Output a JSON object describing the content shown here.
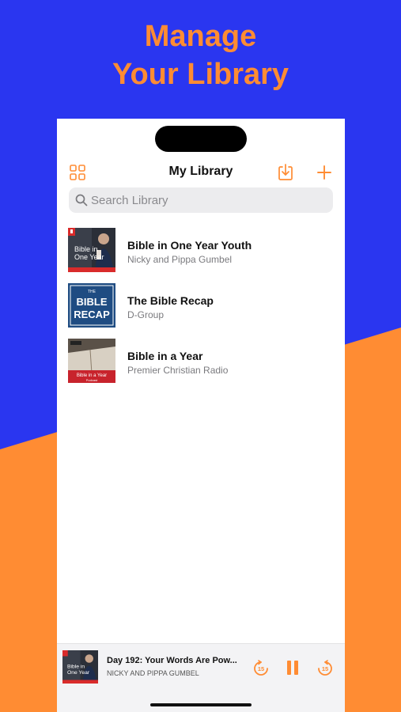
{
  "promo": {
    "headline_line1": "Manage",
    "headline_line2": "Your Library"
  },
  "colors": {
    "brand_blue": "#2a36f0",
    "accent_orange": "#ff8c33"
  },
  "header": {
    "title": "My Library",
    "left_icon": "grid-icon",
    "right_icons": [
      "download-icon",
      "plus-icon"
    ]
  },
  "search": {
    "placeholder": "Search Library"
  },
  "library": {
    "items": [
      {
        "title": "Bible in One Year Youth",
        "author": "Nicky and Pippa Gumbel",
        "art_text": [
          "Bible in",
          "One Year"
        ]
      },
      {
        "title": "The Bible Recap",
        "author": "D-Group",
        "art_text": [
          "THE",
          "BIBLE",
          "RECAP"
        ]
      },
      {
        "title": "Bible in a Year",
        "author": "Premier Christian Radio",
        "art_text": [
          "Bible in a Year",
          "Podcast"
        ]
      }
    ]
  },
  "now_playing": {
    "episode": "Day 192: Your Words Are Pow...",
    "author": "NICKY AND PIPPA GUMBEL",
    "skip_back_seconds": "15",
    "skip_forward_seconds": "15"
  }
}
